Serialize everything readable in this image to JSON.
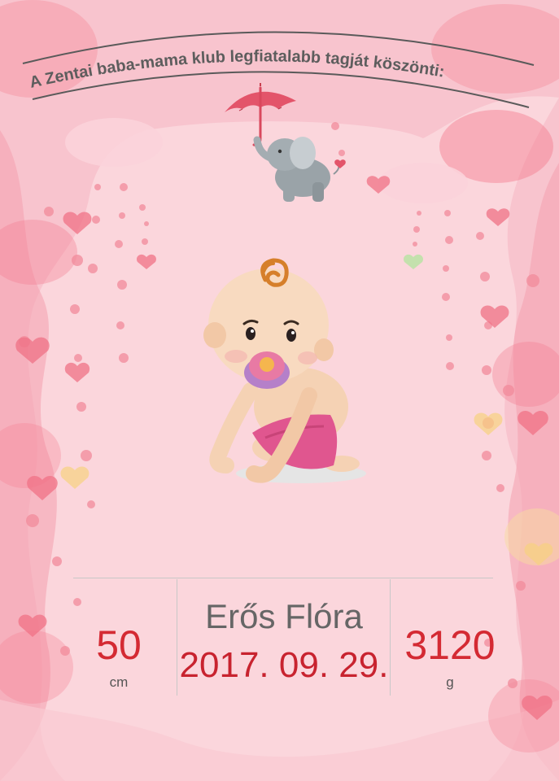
{
  "header": {
    "greeting": "A Zentai baba-mama klub legfiatalabb tagját köszönti:"
  },
  "baby": {
    "name": "Erős Flóra",
    "birth_date": "2017. 09. 29."
  },
  "stats": {
    "length_value": "50",
    "length_unit": "cm",
    "weight_value": "3120",
    "weight_unit": "g"
  },
  "colors": {
    "accent_red": "#d42a33",
    "name_gray": "#666666",
    "frame_pink": "#f6a8b4",
    "frame_light": "#fbd3da"
  },
  "illustrations": {
    "top": "elephant-with-umbrella",
    "center": "baby-with-pacifier"
  }
}
